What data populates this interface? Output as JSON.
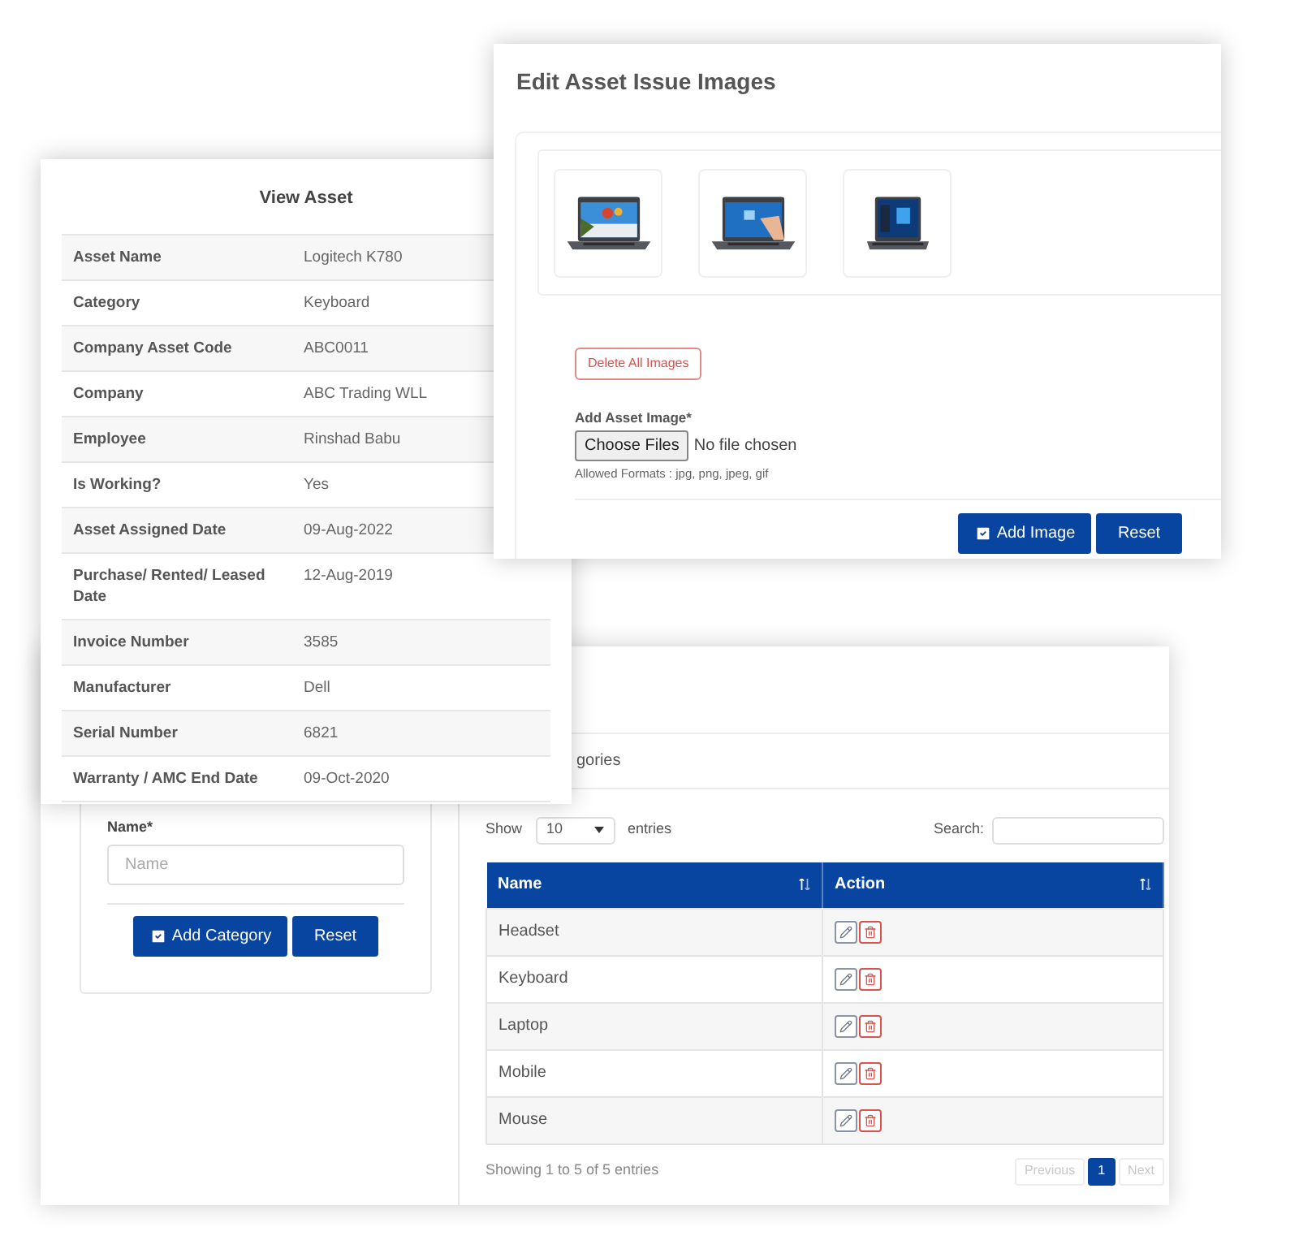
{
  "edit_images": {
    "title": "Edit Asset Issue Images",
    "delete_button": "Delete All Images",
    "file_label": "Add Asset Image*",
    "file_button": "Choose Files",
    "file_status": "No file chosen",
    "hint": "Allowed Formats : jpg, png, jpeg, gif",
    "buttons": [
      {
        "label": "Add Image",
        "kind": "check"
      },
      {
        "label": "Reset",
        "kind": "plain"
      }
    ]
  },
  "view_asset": {
    "title": "View Asset",
    "rows": [
      {
        "label": "Asset Name",
        "value": "Logitech K780"
      },
      {
        "label": "Category",
        "value": "Keyboard"
      },
      {
        "label": "Company Asset Code",
        "value": "ABC0011"
      },
      {
        "label": "Company",
        "value": "ABC Trading WLL"
      },
      {
        "label": "Employee",
        "value": "Rinshad Babu"
      },
      {
        "label": "Is Working?",
        "value": "Yes"
      },
      {
        "label": "Asset Assigned Date",
        "value": "09-Aug-2022"
      },
      {
        "label": "Purchase/ Rented/ Leased Date",
        "value": "12-Aug-2019"
      },
      {
        "label": "Invoice Number",
        "value": "3585"
      },
      {
        "label": "Manufacturer",
        "value": "Dell"
      },
      {
        "label": "Serial Number",
        "value": "6821"
      },
      {
        "label": "Warranty / AMC End Date",
        "value": "09-Oct-2020"
      }
    ]
  },
  "categories": {
    "tab_partial": "gories",
    "form": {
      "label": "Name*",
      "placeholder": "Name",
      "buttons": [
        {
          "label": "Add Category",
          "kind": "check"
        },
        {
          "label": "Reset",
          "kind": "plain"
        }
      ]
    },
    "table": {
      "show_label": "Show",
      "page_size": "10",
      "entries_label": "entries",
      "search_label": "Search:",
      "columns": [
        "Name",
        "Action"
      ],
      "rows": [
        {
          "name": "Headset"
        },
        {
          "name": "Keyboard"
        },
        {
          "name": "Laptop"
        },
        {
          "name": "Mobile"
        },
        {
          "name": "Mouse"
        }
      ],
      "info": "Showing 1 to 5 of 5 entries",
      "pages": [
        {
          "label": "Previous",
          "selected": false,
          "disabled": true
        },
        {
          "label": "1",
          "selected": true,
          "disabled": false
        },
        {
          "label": "Next",
          "selected": false,
          "disabled": true
        }
      ]
    }
  }
}
